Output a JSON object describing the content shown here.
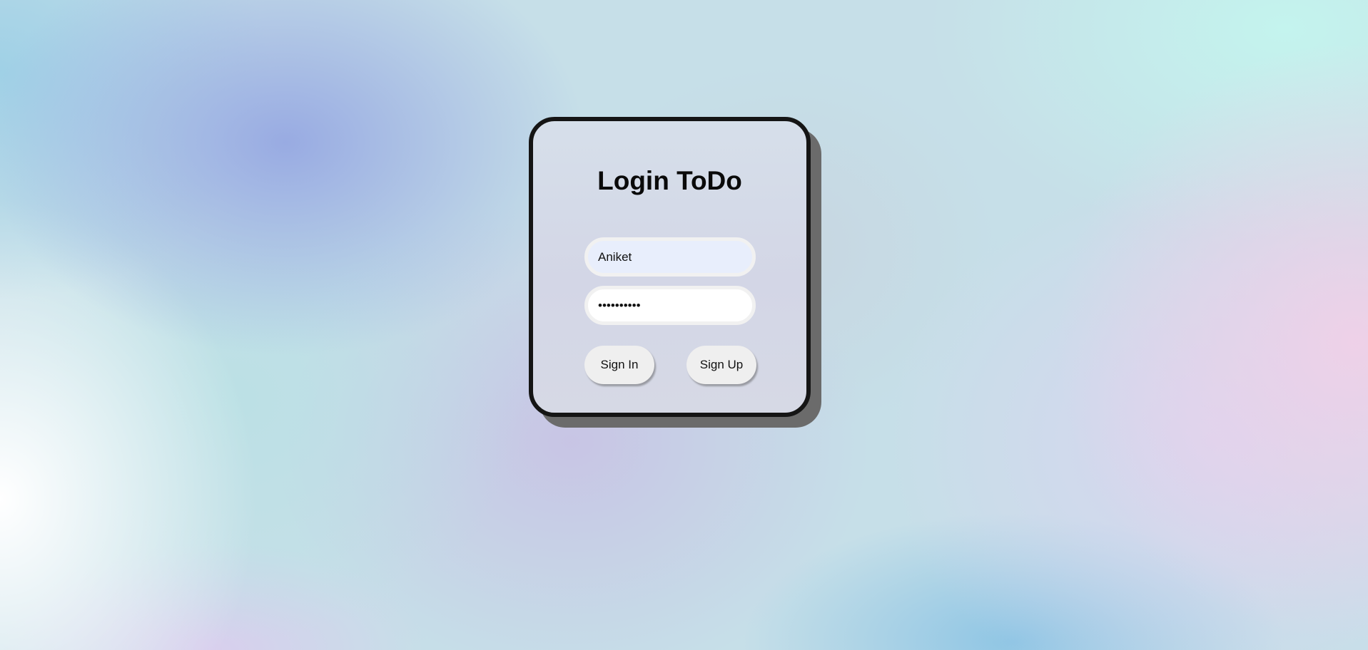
{
  "login": {
    "title": "Login ToDo",
    "username_value": "Aniket",
    "password_value": "••••••••••",
    "signin_label": "Sign In",
    "signup_label": "Sign Up"
  },
  "colors": {
    "card_border": "#151515",
    "card_shadow": "#6b6b6b",
    "button_bg": "#efefef",
    "username_field_bg": "#e8eefc"
  }
}
